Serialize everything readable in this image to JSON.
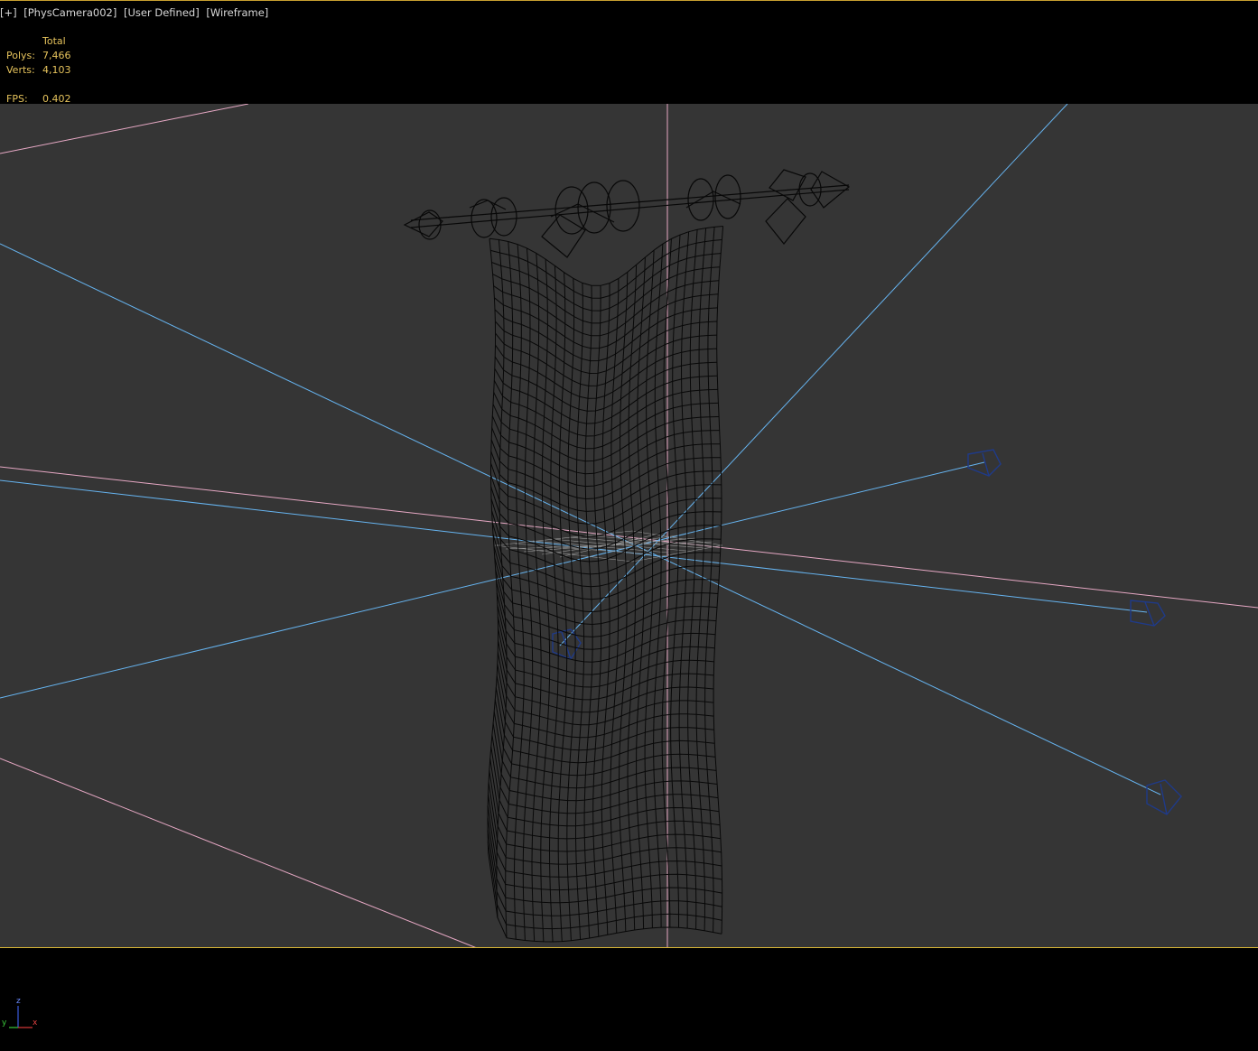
{
  "viewport": {
    "labels": [
      "[+]",
      "[PhysCamera002]",
      "[User Defined]",
      "[Wireframe]"
    ]
  },
  "stats": {
    "header": "Total",
    "polys_label": "Polys:",
    "polys_value": "7,466",
    "verts_label": "Verts:",
    "verts_value": "4,103",
    "fps_label": "FPS:",
    "fps_value": "0.402"
  },
  "gizmo": {
    "z": "z",
    "y": "y",
    "x": "x"
  },
  "colors": {
    "scene_bg": "#353535",
    "frame": "#d8b636",
    "light_lines": "#66b4f0",
    "grid_lines": "#e6a8c4",
    "wire": "#080808",
    "stats_text": "#e6c35c"
  }
}
